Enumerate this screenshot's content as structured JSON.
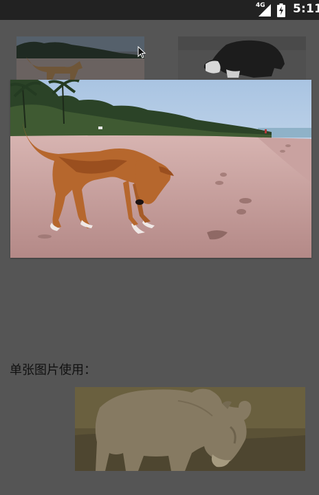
{
  "status_bar": {
    "network": "4G",
    "time": "5:11"
  },
  "content": {
    "section_label": "单张图片使用："
  },
  "colors": {
    "background": "#555555",
    "status_bar": "#222222"
  }
}
